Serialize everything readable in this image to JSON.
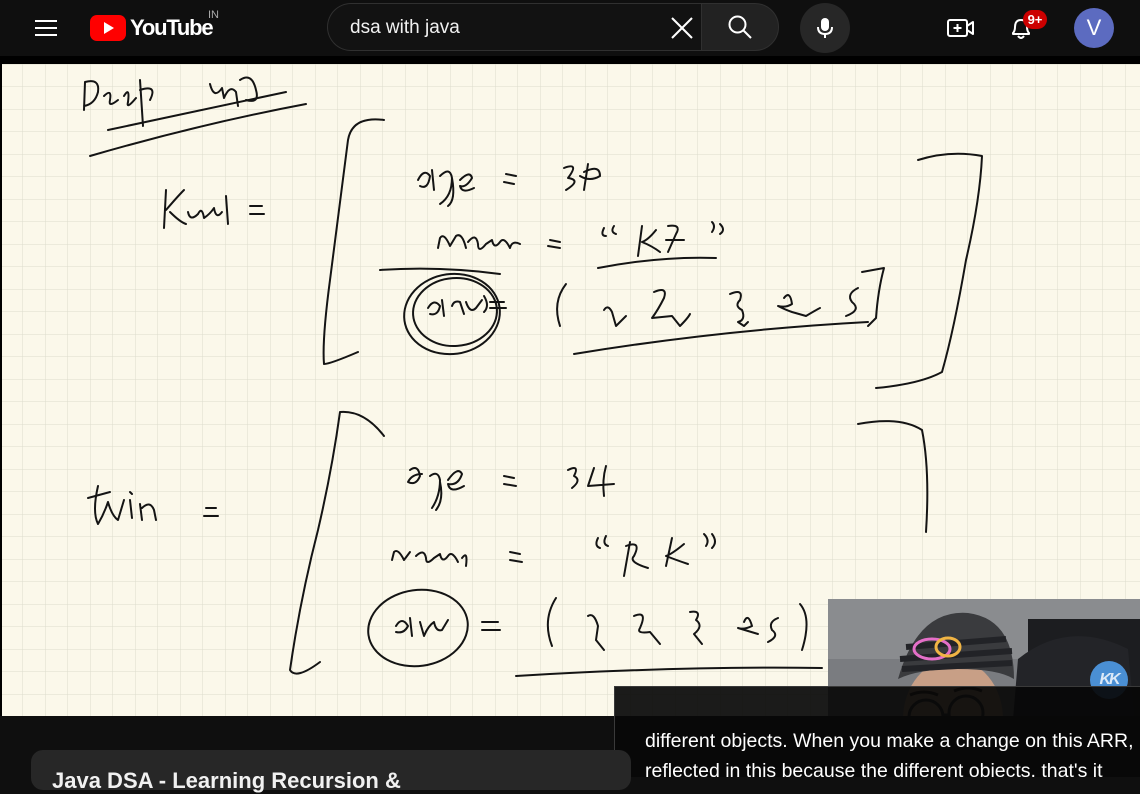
{
  "header": {
    "logo_text": "YouTube",
    "country_code": "IN",
    "search": {
      "value": "dsa with java",
      "placeholder": "Search"
    },
    "notification_count": "9+",
    "avatar_initial": "V"
  },
  "video": {
    "caption_lines": [
      "different objects. When you make a change on this ARR, it will not be",
      "reflected in this because the different objects, that's it"
    ]
  },
  "below": {
    "title_partial": "Java DSA - Learning Recursion &"
  },
  "colors": {
    "background": "#0f0f0f",
    "brand_red": "#ff0000",
    "badge_red": "#cc0000",
    "avatar": "#5c6bc0",
    "paper": "#fbf8ea",
    "grid": "#dcdccc"
  },
  "icons": [
    "menu-icon",
    "youtube-logo-icon",
    "clear-icon",
    "search-icon",
    "mic-icon",
    "create-icon",
    "bell-icon",
    "kk-channel-logo"
  ]
}
